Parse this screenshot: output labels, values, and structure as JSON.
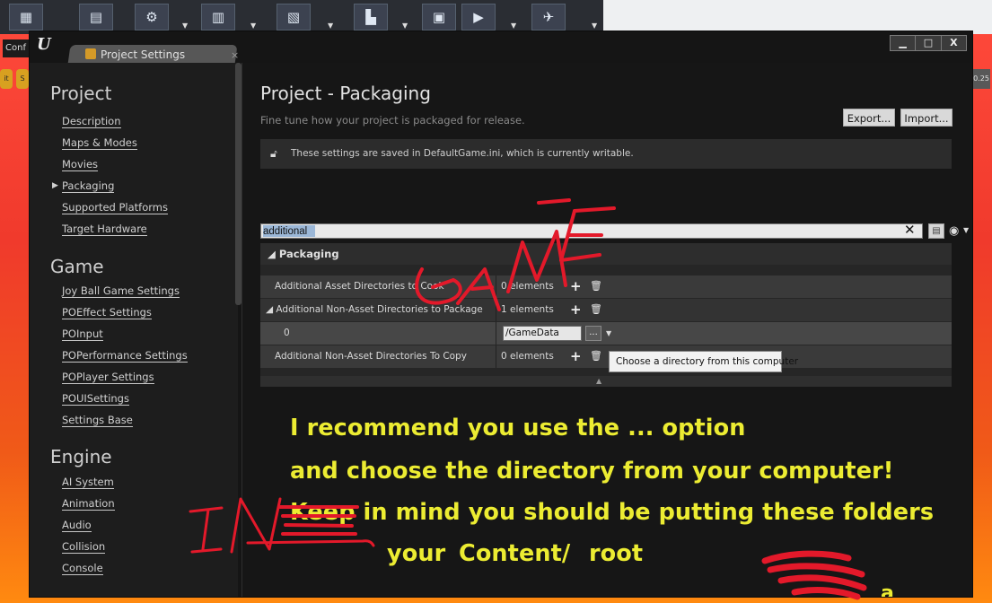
{
  "background": {
    "left_label": "Conf",
    "chips": [
      "it",
      "S"
    ],
    "right_chip": "0.25",
    "toolbar_icons": [
      "content-icon",
      "marketplace-icon",
      "settings-icon",
      "blueprints-icon",
      "cinematics-icon",
      "build-icon",
      "compile-icon",
      "play-icon",
      "launch-icon"
    ]
  },
  "window": {
    "tab_label": "Project Settings",
    "tab_close": "×",
    "controls": [
      "▁",
      "□",
      "X"
    ]
  },
  "sidebar": {
    "sections": [
      {
        "title": "Project",
        "items": [
          "Description",
          "Maps & Modes",
          "Movies",
          "Packaging",
          "Supported Platforms",
          "Target Hardware"
        ]
      },
      {
        "title": "Game",
        "items": [
          "Joy Ball Game Settings",
          "POEffect Settings",
          "POInput",
          "POPerformance Settings",
          "POPlayer Settings",
          "POUISettings",
          "Settings Base"
        ]
      },
      {
        "title": "Engine",
        "items": [
          "AI System",
          "Animation",
          "Audio",
          "Collision",
          "Console"
        ]
      }
    ],
    "active_item": "Packaging"
  },
  "main": {
    "title": "Project - Packaging",
    "subtitle": "Fine tune how your project is packaged for release.",
    "export_label": "Export...",
    "import_label": "Import...",
    "notice": "These settings are saved in DefaultGame.ini, which is currently writable.",
    "search_value": "additional",
    "category": "◢ Packaging",
    "rows": [
      {
        "name": "Additional Asset Directories to Cook",
        "value": "0 elements"
      },
      {
        "name": "◢ Additional Non-Asset Directories to Package",
        "value": "1 elements"
      },
      {
        "name": "0",
        "value": "/GameData"
      },
      {
        "name": "Additional Non-Asset Directories To Copy",
        "value": "0 elements"
      }
    ],
    "browse_label": "...",
    "tooltip": "Choose a directory from this computer"
  },
  "annotation": {
    "lines": [
      "I recommend you use the ... option",
      "and choose the directory from your computer!",
      "Keep in mind you should be putting these folders",
      "your",
      "Content/",
      "root"
    ],
    "handwritten": "GAME",
    "signature": "a",
    "ink_color": "#e3192a",
    "text_color": "#ecec32"
  }
}
